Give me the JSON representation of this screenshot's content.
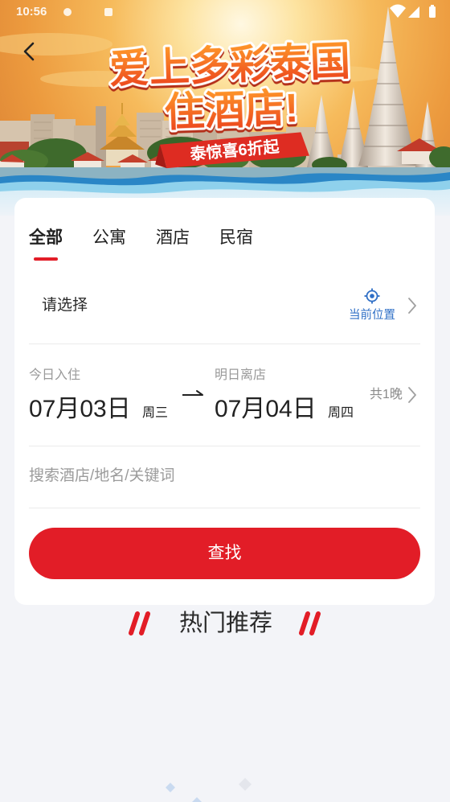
{
  "status_bar": {
    "time": "10:56",
    "icons": [
      "notification-icon",
      "notification-icon",
      "wifi-icon",
      "signal-icon",
      "battery-icon"
    ]
  },
  "nav": {
    "back_icon": "chevron-left-icon"
  },
  "banner": {
    "headline_line1": "爱上多彩泰国",
    "headline_line2": "住酒店!",
    "ribbon_text": "泰惊喜6折起"
  },
  "tabs": [
    {
      "label": "全部",
      "active": true
    },
    {
      "label": "公寓",
      "active": false
    },
    {
      "label": "酒店",
      "active": false
    },
    {
      "label": "民宿",
      "active": false
    }
  ],
  "destination": {
    "value": "请选择",
    "current_location_label": "当前位置",
    "current_location_icon": "locate-icon",
    "chevron_icon": "chevron-right-icon"
  },
  "dates": {
    "checkin_label": "今日入住",
    "checkin_date": "07月03日",
    "checkin_weekday": "周三",
    "checkout_label": "明日离店",
    "checkout_date": "07月04日",
    "checkout_weekday": "周四",
    "nights": "共1晚",
    "range_icon": "arrow-right-icon"
  },
  "search": {
    "placeholder": "搜索酒店/地名/关键词"
  },
  "submit_button": {
    "label": "查找"
  },
  "recommend": {
    "title": "热门推荐"
  },
  "colors": {
    "accent": "#e21d27",
    "link": "#2f6fc6"
  }
}
